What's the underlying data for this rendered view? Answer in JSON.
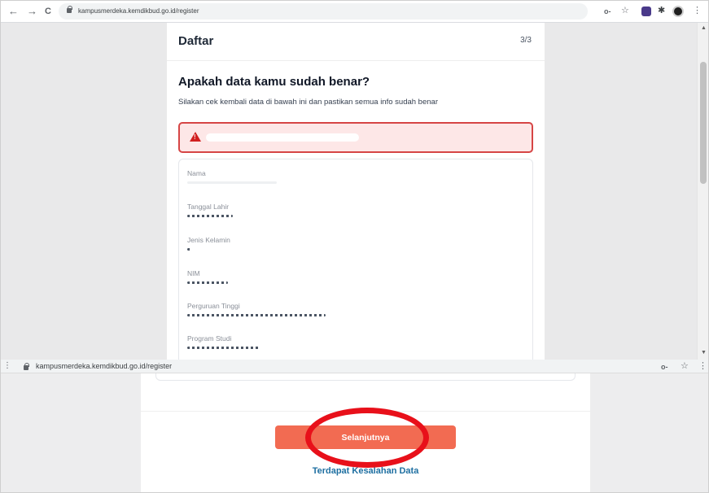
{
  "browser_top": {
    "url": "kampusmerdeka.kemdikbud.go.id/register",
    "back_icon": "←",
    "forward_icon": "→",
    "reload_icon": "C",
    "key_icon": "o-",
    "star_icon": "☆",
    "puzzle_icon": "✱",
    "menu_icon": "⋮"
  },
  "browser_bottom": {
    "url": "kampusmerdeka.kemdikbud.go.id/register",
    "key_icon": "o-",
    "star_icon": "☆",
    "menu_icon": "⋮"
  },
  "header": {
    "title": "Daftar",
    "step": "3/3"
  },
  "main": {
    "headline": "Apakah data kamu sudah benar?",
    "subtext": "Silakan cek kembali data di bawah ini dan pastikan semua info sudah benar"
  },
  "fields": [
    {
      "label": "Nama"
    },
    {
      "label": "Tanggal Lahir"
    },
    {
      "label": "Jenis Kelamin"
    },
    {
      "label": "NIM"
    },
    {
      "label": "Perguruan Tinggi"
    },
    {
      "label": "Program Studi"
    }
  ],
  "actions": {
    "next_label": "Selanjutnya",
    "error_link": "Terdapat Kesalahan Data"
  },
  "colors": {
    "accent": "#f26b52",
    "alert_border": "#d64545",
    "alert_bg": "#fde7e7",
    "link": "#1e6fa1",
    "highlight": "#e8101a"
  }
}
